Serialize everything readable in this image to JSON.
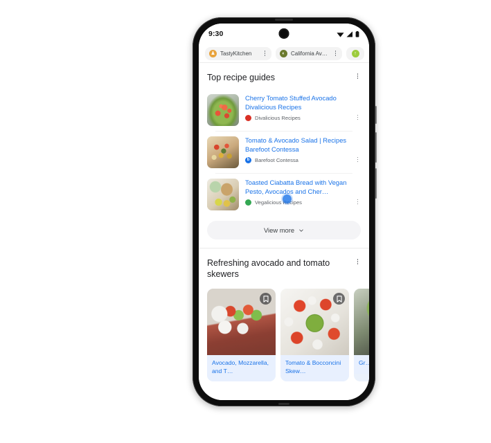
{
  "status_bar": {
    "time": "9:30",
    "icons": [
      "wifi-icon",
      "signal-icon",
      "battery-icon"
    ]
  },
  "browser": {
    "tabs": [
      {
        "label": "TastyKitchen",
        "favicon": "tastykitchen-favicon",
        "favicon_color": "#e8a33d",
        "favicon_glyph": "♟",
        "menu": "tab-menu"
      },
      {
        "label": "California Av…",
        "favicon": "california-avocado-favicon",
        "favicon_color": "#6b7a2e",
        "favicon_glyph": "◐",
        "menu": "tab-menu"
      },
      {
        "label": "",
        "favicon": "green-site-favicon",
        "favicon_color": "#9ccc3c",
        "favicon_glyph": "↑",
        "menu": ""
      }
    ]
  },
  "sections": [
    {
      "title": "Top recipe guides",
      "menu_label": "section-menu",
      "results": [
        {
          "title": "Cherry Tomato Stuffed Avocado Divalicious Recipes",
          "source": "Divalicious Recipes",
          "favicon_color": "#d93025",
          "favicon_glyph": "●",
          "thumb": "cherry-tomato-stuffed-avocado-photo",
          "thumb_style": "p-avocado"
        },
        {
          "title": "Tomato & Avocado Salad | Recipes Barefoot Contessa",
          "source": "Barefoot Contessa",
          "favicon_color": "#1a73e8",
          "favicon_glyph": "b",
          "thumb": "tomato-avocado-salad-photo",
          "thumb_style": "p-salad"
        },
        {
          "title": "Toasted Ciabatta Bread with Vegan Pesto, Avocados and Cher…",
          "source": "Vegalicious Recipes",
          "favicon_color": "#34a853",
          "favicon_glyph": "●",
          "thumb": "toasted-ciabatta-bread-photo",
          "thumb_style": "p-bread"
        }
      ],
      "view_more_label": "View more"
    },
    {
      "title": "Refreshing avocado and tomato skewers",
      "menu_label": "section-menu",
      "cards": [
        {
          "caption": "Avocado, Mozzarella, and T…",
          "image": "avocado-mozzarella-skewers-photo",
          "image_style": "p-skewers",
          "bookmark": "bookmark-icon"
        },
        {
          "caption": "Tomato & Bocconcini Skew…",
          "image": "tomato-bocconcini-skewers-photo",
          "image_style": "p-bocconcini",
          "bookmark": "bookmark-icon"
        },
        {
          "caption": "Gr… B…",
          "image": "grilled-skewers-photo",
          "image_style": "p-grilled",
          "bookmark": ""
        }
      ]
    }
  ],
  "colors": {
    "link": "#1a73e8",
    "text": "#202124",
    "muted": "#5f6368",
    "cursor": "#1a73e8"
  }
}
